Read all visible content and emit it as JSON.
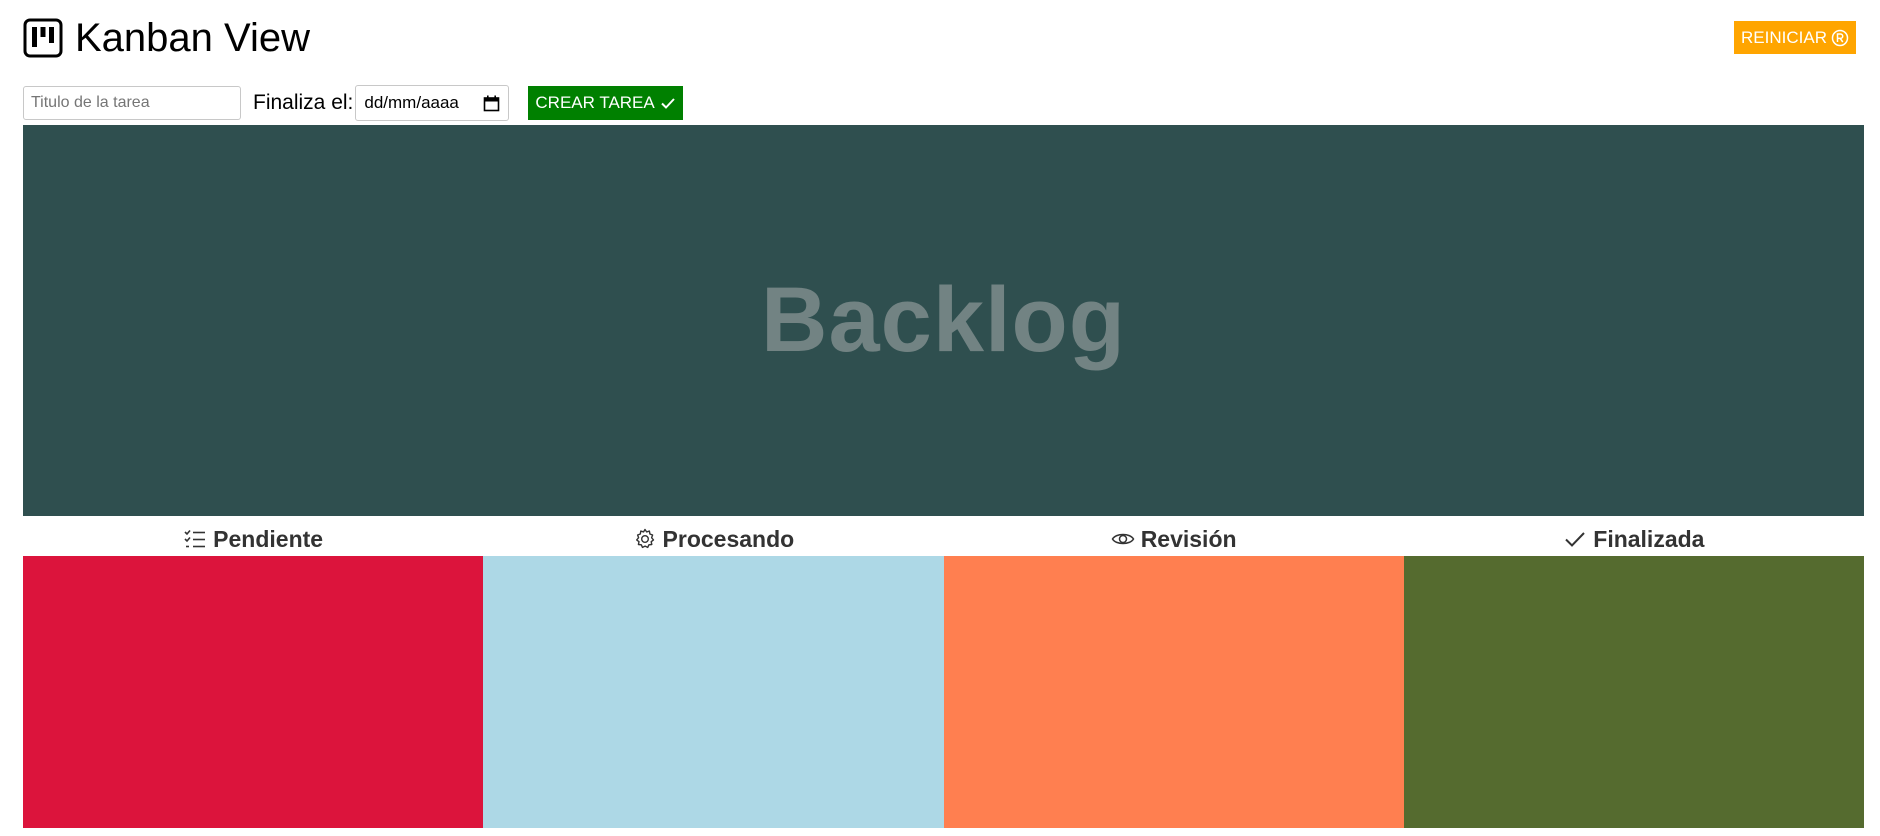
{
  "app": {
    "title": "Kanban View",
    "logo_icon": "kanban-board-icon"
  },
  "toolbar": {
    "reset_label": "REINICIAR",
    "reset_icon": "registered-circle-icon",
    "reset_color": "#ffa500"
  },
  "form": {
    "title_placeholder": "Titulo de la tarea",
    "title_value": "",
    "date_label": "Finaliza el:",
    "date_placeholder": "dd/mm/aaaa",
    "create_label": "CREAR TAREA",
    "create_icon": "check-icon",
    "create_color": "#008000"
  },
  "backlog": {
    "title": "Backlog",
    "color": "#2f4f4f"
  },
  "columns": [
    {
      "label": "Pendiente",
      "icon": "checklist-icon",
      "color": "#dc143c"
    },
    {
      "label": "Procesando",
      "icon": "gear-icon",
      "color": "#add8e6"
    },
    {
      "label": "Revisión",
      "icon": "eye-icon",
      "color": "#ff7f50"
    },
    {
      "label": "Finalizada",
      "icon": "check-icon",
      "color": "#556b2f"
    }
  ]
}
